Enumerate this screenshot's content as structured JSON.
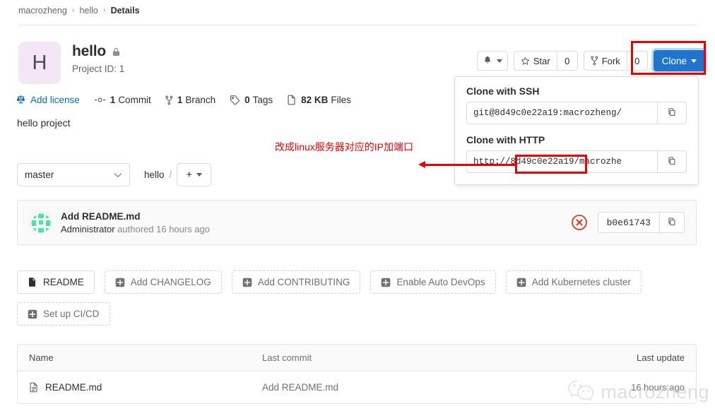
{
  "breadcrumb": {
    "group": "macrozheng",
    "project": "hello",
    "current": "Details",
    "separator": "›"
  },
  "project": {
    "avatar_letter": "H",
    "name": "hello",
    "visibility_icon": "lock-icon",
    "project_id_label": "Project ID: 1",
    "description": "hello project"
  },
  "header_actions": {
    "notification_icon": "bell-icon",
    "star_label": "Star",
    "star_count": "0",
    "fork_label": "Fork",
    "fork_count": "0",
    "clone_label": "Clone",
    "clone_button_color": "#1f75cb"
  },
  "clone_dropdown": {
    "ssh_label": "Clone with SSH",
    "ssh_value": "git@8d49c0e22a19:macrozheng/",
    "http_label": "Clone with HTTP",
    "http_prefix": "http://",
    "http_host": "8d49c0e22a19",
    "http_suffix": "/macrozhe",
    "copy_icon": "copy-icon"
  },
  "annotation": {
    "text": "改成linux服务器对应的IP加端口",
    "color": "#ef0000"
  },
  "stats": [
    {
      "icon": "license-icon",
      "value": "",
      "label": "Add license",
      "is_link": true
    },
    {
      "icon": "commit-icon",
      "value": "1",
      "label": "Commit",
      "is_link": false
    },
    {
      "icon": "branch-icon",
      "value": "1",
      "label": "Branch",
      "is_link": false
    },
    {
      "icon": "tag-icon",
      "value": "0",
      "label": "Tags",
      "is_link": false
    },
    {
      "icon": "files-icon",
      "value": "82 KB",
      "label": "Files",
      "is_link": false
    }
  ],
  "branch_row": {
    "branch": "master",
    "path": "hello",
    "slash": "/",
    "plus_label": "+"
  },
  "last_commit": {
    "avatar_icon": "identicon-avatar",
    "title": "Add README.md",
    "author": "Administrator",
    "meta": " authored 16 hours ago",
    "status_icon": "failed-status-icon",
    "sha": "b0e61743",
    "copy_icon": "copy-icon"
  },
  "quick_actions": [
    {
      "label": "README",
      "icon": "file-icon",
      "style": "solid"
    },
    {
      "label": "Add CHANGELOG",
      "icon": "plus-box-icon",
      "style": "dashed"
    },
    {
      "label": "Add CONTRIBUTING",
      "icon": "plus-box-icon",
      "style": "dashed"
    },
    {
      "label": "Enable Auto DevOps",
      "icon": "plus-box-icon",
      "style": "dashed"
    },
    {
      "label": "Add Kubernetes cluster",
      "icon": "plus-box-icon",
      "style": "dashed"
    },
    {
      "label": "Set up CI/CD",
      "icon": "plus-box-icon",
      "style": "dashed"
    }
  ],
  "files_table": {
    "columns": {
      "name": "Name",
      "last_commit": "Last commit",
      "last_update": "Last update"
    },
    "rows": [
      {
        "icon": "file-icon",
        "name": "README.md",
        "last_commit": "Add README.md",
        "last_update": "16 hours ago"
      }
    ]
  },
  "watermark": {
    "icon": "wechat-icon",
    "text": "macrozheng"
  }
}
